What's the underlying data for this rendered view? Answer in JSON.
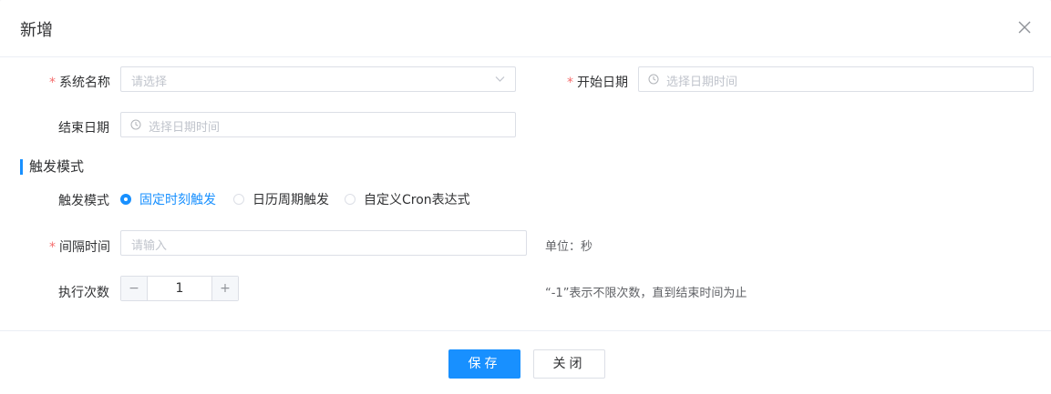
{
  "dialog": {
    "title": "新增"
  },
  "form": {
    "system_name": {
      "required_mark": "*",
      "label": "系统名称",
      "placeholder": "请选择"
    },
    "start_date": {
      "required_mark": "*",
      "label": "开始日期",
      "placeholder": "选择日期时间"
    },
    "end_date": {
      "label": "结束日期",
      "placeholder": "选择日期时间"
    },
    "section_title": "触发模式",
    "trigger_mode": {
      "label": "触发模式",
      "options": [
        "固定时刻触发",
        "日历周期触发",
        "自定义Cron表达式"
      ],
      "selected": "固定时刻触发"
    },
    "interval": {
      "required_mark": "*",
      "label": "间隔时间",
      "placeholder": "请输入",
      "unit_hint": "单位：秒"
    },
    "exec_count": {
      "label": "执行次数",
      "value": "1",
      "minus": "−",
      "plus": "+",
      "hint": "“-1”表示不限次数，直到结束时间为止"
    }
  },
  "footer": {
    "save_label": "保存",
    "close_label": "关闭"
  },
  "icons": {
    "close": "close-icon",
    "select_arrow": "chevron-down-icon",
    "date": "clock-icon"
  },
  "colors": {
    "primary": "#1890ff",
    "required": "#f56c6c",
    "placeholder": "#c0c4cc",
    "border": "#dcdfe6"
  }
}
